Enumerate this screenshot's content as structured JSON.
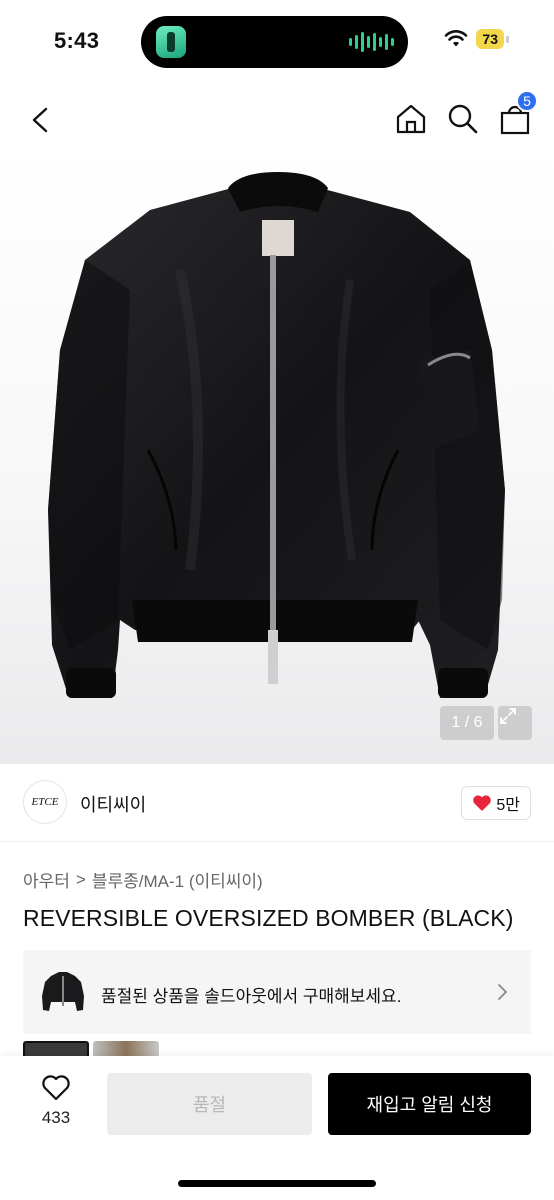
{
  "status_bar": {
    "time": "5:43",
    "battery": "73"
  },
  "nav": {
    "cart_count": "5"
  },
  "hero": {
    "image_counter": "1 / 6"
  },
  "brand": {
    "logo_text": "ETCE",
    "name": "이티씨이",
    "likes": "5만"
  },
  "breadcrumb": {
    "category": "아우터",
    "separator": ">",
    "subcategory": "블루종/MA-1 (이티씨이)"
  },
  "product": {
    "title": "REVERSIBLE OVERSIZED BOMBER (BLACK)"
  },
  "soldout_banner": {
    "text": "품절된 상품을 솔드아웃에서 구매해보세요."
  },
  "bottom_bar": {
    "wish_count": "433",
    "soldout_label": "품절",
    "restock_label": "재입고 알림 신청"
  },
  "colors": {
    "accent_blue": "#2e6ff2",
    "heart_red": "#e8253b",
    "battery_yellow": "#f2d64b"
  }
}
